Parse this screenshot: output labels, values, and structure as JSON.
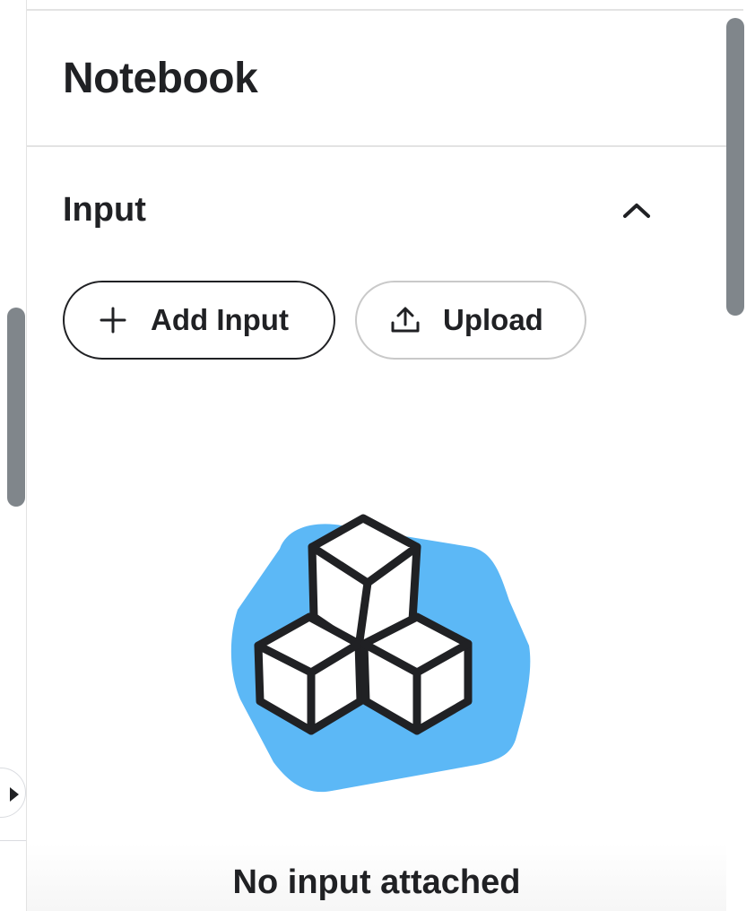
{
  "header": {
    "title": "Notebook"
  },
  "input_section": {
    "title": "Input",
    "collapse_icon": "chevron-up-icon",
    "buttons": {
      "add_input": {
        "label": "Add Input",
        "icon": "plus-icon"
      },
      "upload": {
        "label": "Upload",
        "icon": "upload-icon"
      }
    },
    "empty_state": {
      "illustration": "cubes-illustration",
      "message": "No input attached"
    }
  },
  "colors": {
    "text": "#202124",
    "illustration_blob": "#5cb8f6",
    "scrollbar": "#80868b",
    "border_light": "#c9c9c9"
  }
}
